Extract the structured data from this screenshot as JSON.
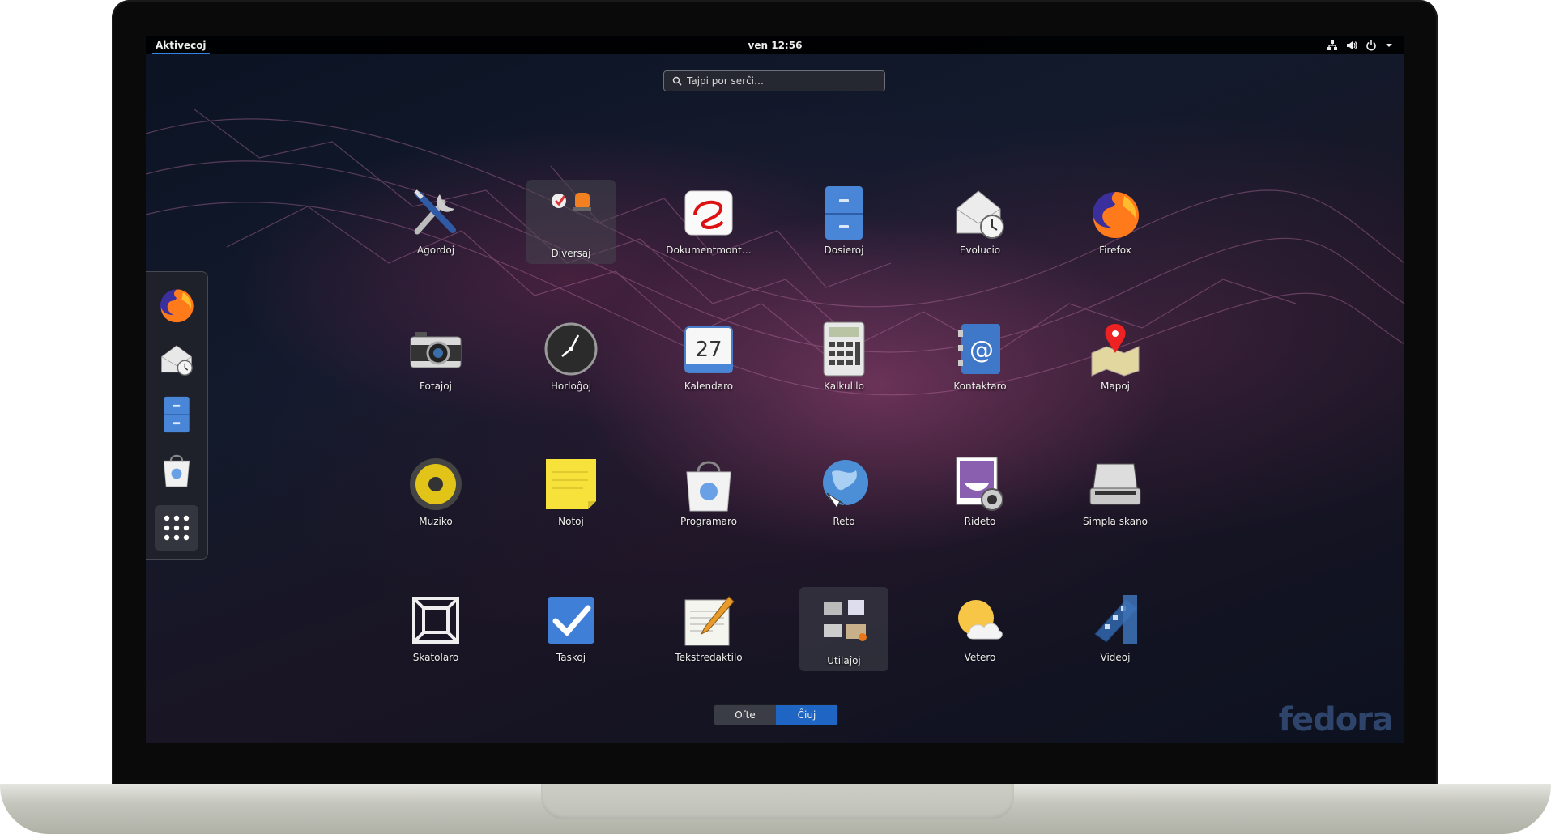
{
  "topbar": {
    "activities": "Aktivecoj",
    "clock": "ven 12:56",
    "tray_icons": [
      "network-icon",
      "volume-icon",
      "power-icon",
      "dropdown-arrow-icon"
    ]
  },
  "search": {
    "placeholder": "Tajpi por serĉi…"
  },
  "dash": {
    "items": [
      {
        "name": "Firefox",
        "icon": "firefox-icon"
      },
      {
        "name": "Evolucio",
        "icon": "evolution-icon"
      },
      {
        "name": "Dosieroj",
        "icon": "files-icon"
      },
      {
        "name": "Programaro",
        "icon": "software-icon"
      },
      {
        "name": "Montri aplikaĵojn",
        "icon": "app-grid-icon"
      }
    ]
  },
  "apps": [
    {
      "label": "Agordoj",
      "icon": "settings-icon"
    },
    {
      "label": "Diversaj",
      "icon": "folder-icon",
      "folder": true
    },
    {
      "label": "Dokumentmont…",
      "icon": "document-viewer-icon"
    },
    {
      "label": "Dosieroj",
      "icon": "files-icon"
    },
    {
      "label": "Evolucio",
      "icon": "evolution-icon"
    },
    {
      "label": "Firefox",
      "icon": "firefox-icon"
    },
    {
      "label": "Fotajoj",
      "icon": "camera-icon"
    },
    {
      "label": "Horloĝoj",
      "icon": "clock-icon"
    },
    {
      "label": "Kalendaro",
      "icon": "calendar-icon",
      "day": "27"
    },
    {
      "label": "Kalkulilo",
      "icon": "calculator-icon"
    },
    {
      "label": "Kontaktaro",
      "icon": "contacts-icon"
    },
    {
      "label": "Mapoj",
      "icon": "maps-icon"
    },
    {
      "label": "Muziko",
      "icon": "music-icon"
    },
    {
      "label": "Notoj",
      "icon": "notes-icon"
    },
    {
      "label": "Programaro",
      "icon": "software-icon"
    },
    {
      "label": "Reto",
      "icon": "web-icon"
    },
    {
      "label": "Rideto",
      "icon": "cheese-icon"
    },
    {
      "label": "Simpla skano",
      "icon": "scanner-icon"
    },
    {
      "label": "Skatolaro",
      "icon": "boxes-icon"
    },
    {
      "label": "Taskoj",
      "icon": "tasks-icon"
    },
    {
      "label": "Tekstredaktilo",
      "icon": "text-editor-icon"
    },
    {
      "label": "Utilaĵoj",
      "icon": "folder-icon",
      "folder": true
    },
    {
      "label": "Vetero",
      "icon": "weather-icon"
    },
    {
      "label": "Videoj",
      "icon": "videos-icon"
    }
  ],
  "view_tabs": {
    "frequent": "Ofte",
    "all": "Ĉiuj",
    "selected": "all"
  },
  "brand": "fedora",
  "colors": {
    "accent": "#1f65c3",
    "topbar": "#000000",
    "activities_underline": "#3584e4"
  }
}
